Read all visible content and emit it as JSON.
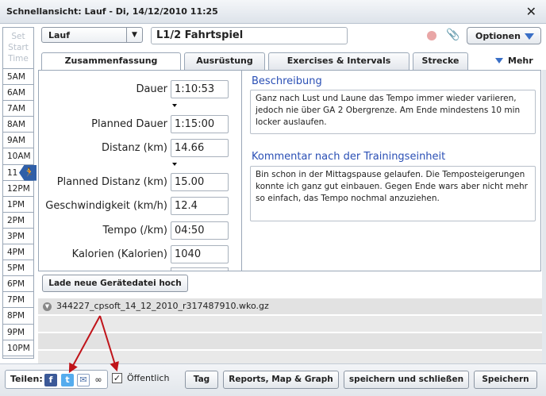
{
  "window": {
    "title": "Schnellansicht: Lauf - Di, 14/12/2010 11:25",
    "close_glyph": "✕"
  },
  "timeline": {
    "set_start": [
      "Set",
      "Start",
      "Time"
    ],
    "hours": [
      "5AM",
      "6AM",
      "7AM",
      "8AM",
      "9AM",
      "10AM",
      "11",
      "12PM",
      "1PM",
      "2PM",
      "3PM",
      "4PM",
      "5PM",
      "6PM",
      "7PM",
      "8PM",
      "9PM",
      "10PM"
    ]
  },
  "toolbar": {
    "sport": "Lauf",
    "workout_title": "L1/2 Fahrtspiel",
    "options_label": "Optionen"
  },
  "tabs": [
    "Zusammenfassung",
    "Ausrüstung",
    "Exercises & Intervals",
    "Strecke"
  ],
  "more_label": "Mehr",
  "fields": [
    {
      "label": "Dauer",
      "value": "1:10:53"
    },
    {
      "label": "Planned Dauer",
      "value": "1:15:00"
    },
    {
      "label": "Distanz (km)",
      "value": "14.66"
    },
    {
      "label": "Planned Distanz (km)",
      "value": "15.00"
    },
    {
      "label": "Geschwindigkeit (km/h)",
      "value": "12.4"
    },
    {
      "label": "Tempo (/km)",
      "value": "04:50"
    },
    {
      "label": "Kalorien (Kalorien)",
      "value": "1040"
    }
  ],
  "description": {
    "heading": "Beschreibung",
    "text": "Ganz nach Lust und Laune das Tempo immer wieder variieren, jedoch nie über GA 2 Obergrenze. Am Ende mindestens 10 min locker auslaufen."
  },
  "comment": {
    "heading": "Kommentar nach der Trainingseinheit",
    "text": "Bin schon in der Mittagspause gelaufen. Die Temposteigerungen konnte ich ganz gut einbauen. Gegen Ende wars aber nicht mehr so einfach, das Tempo nochmal anzuziehen."
  },
  "upload_label": "Lade neue Gerätedatei hoch",
  "files": [
    "344227_cpsoft_14_12_2010_r317487910.wko.gz"
  ],
  "footer": {
    "share_label": "Teilen:",
    "share_icons": [
      "facebook-icon",
      "twitter-icon",
      "email-icon",
      "link-icon"
    ],
    "public_label": "Öffentlich",
    "public_checked": true,
    "buttons": [
      "Tag",
      "Reports, Map & Graph",
      "speichern und schließen",
      "Speichern"
    ]
  },
  "colors": {
    "accent": "#2a4fb5",
    "annotation_arrow": "#c0141a",
    "facebook": "#3b5998",
    "twitter": "#55acee"
  }
}
